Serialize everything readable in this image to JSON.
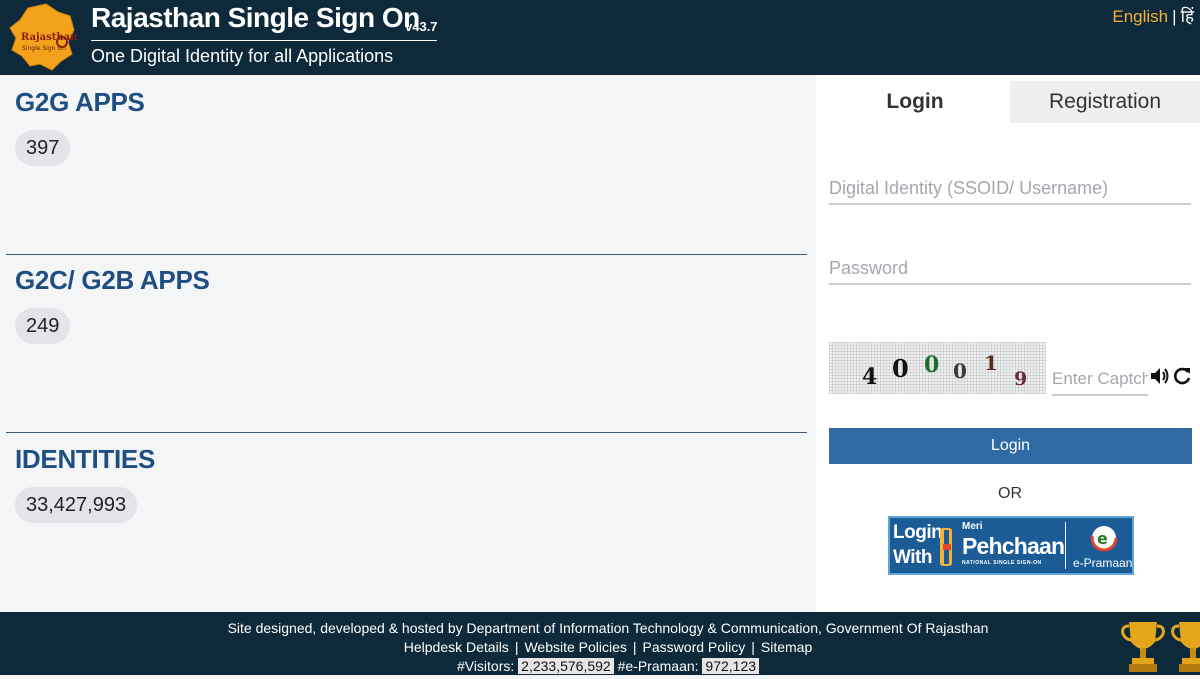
{
  "header": {
    "title": "Rajasthan Single Sign On",
    "version": "v43.7",
    "subtitle": "One Digital Identity for all Applications",
    "logo_text": "Rajasthan Single Sign On",
    "lang_english": "English",
    "lang_separator": "|",
    "lang_hindi": "हिं"
  },
  "stats": [
    {
      "title": "G2G APPS",
      "value": "397"
    },
    {
      "title": "G2C/ G2B APPS",
      "value": "249"
    },
    {
      "title": "IDENTITIES",
      "value": "33,427,993"
    }
  ],
  "login_panel": {
    "tabs": [
      "Login",
      "Registration"
    ],
    "username_placeholder": "Digital Identity (SSOID/ Username)",
    "password_placeholder": "Password",
    "captcha_chars": [
      "4",
      "0",
      "0",
      "0",
      "1",
      "9"
    ],
    "captcha_placeholder": "Enter Captcha",
    "login_button": "Login",
    "or_text": "OR",
    "pehchaan": {
      "login_with_1": "Login",
      "login_with_2": "With",
      "meri": "Meri",
      "name": "Pehchaan",
      "tagline": "NATIONAL SINGLE SIGN-ON",
      "epramaan": "e-Pramaan"
    }
  },
  "footer": {
    "line1": "Site designed, developed & hosted by Department of Information Technology & Communication, Government Of Rajasthan",
    "links": [
      "Helpdesk Details",
      "Website Policies",
      "Password Policy",
      "Sitemap"
    ],
    "visitors_label": "#Visitors:",
    "visitors_value": "2,233,576,592",
    "epramaan_label": "#e-Pramaan:",
    "epramaan_value": "972,123"
  },
  "colors": {
    "header_bg": "#0e2a3a",
    "accent_blue": "#1f4f82",
    "button_blue": "#2f6aa5",
    "language_orange": "#f4b13a"
  }
}
